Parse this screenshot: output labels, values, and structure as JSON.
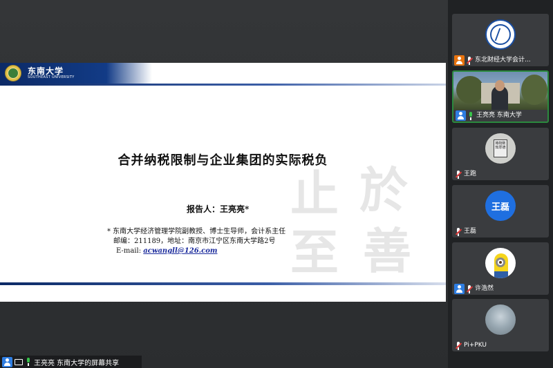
{
  "slide": {
    "logo_cn": "东南大学",
    "logo_en": "SOUTHEAST UNIVERSITY",
    "title": "合并纳税限制与企业集团的实际税负",
    "presenter": "报告人：王亮亮*",
    "note_line1": "*  东南大学经济管理学院副教授、博士生导师，会计系主任",
    "note_line2": "邮编：211189，地址：南京市江宁区东南大学路2号",
    "email_label": "E-mail: ",
    "email": "acwangll@126.com",
    "calligraphy": [
      "止",
      "於",
      "至",
      "善"
    ]
  },
  "participants": [
    {
      "name": "东北财经大学会计...",
      "role": "host",
      "mic": "muted",
      "avatar": "university-seal"
    },
    {
      "name": "王亮亮 东南大学",
      "role": "user",
      "mic": "active",
      "avatar": "camera-video",
      "active": true
    },
    {
      "name": "王跑",
      "role": "none",
      "mic": "muted",
      "avatar": "plaque-photo",
      "plaque_text": "格物致知厚德"
    },
    {
      "name": "王磊",
      "role": "none",
      "mic": "muted",
      "avatar": "text",
      "avatar_text": "王磊"
    },
    {
      "name": "许浩然",
      "role": "user",
      "mic": "muted",
      "avatar": "minion"
    },
    {
      "name": "Pi+PKU",
      "role": "none",
      "mic": "muted",
      "avatar": "sky-photo"
    }
  ],
  "share_bar": {
    "text": "王亮亮 东南大学的屏幕共享"
  }
}
